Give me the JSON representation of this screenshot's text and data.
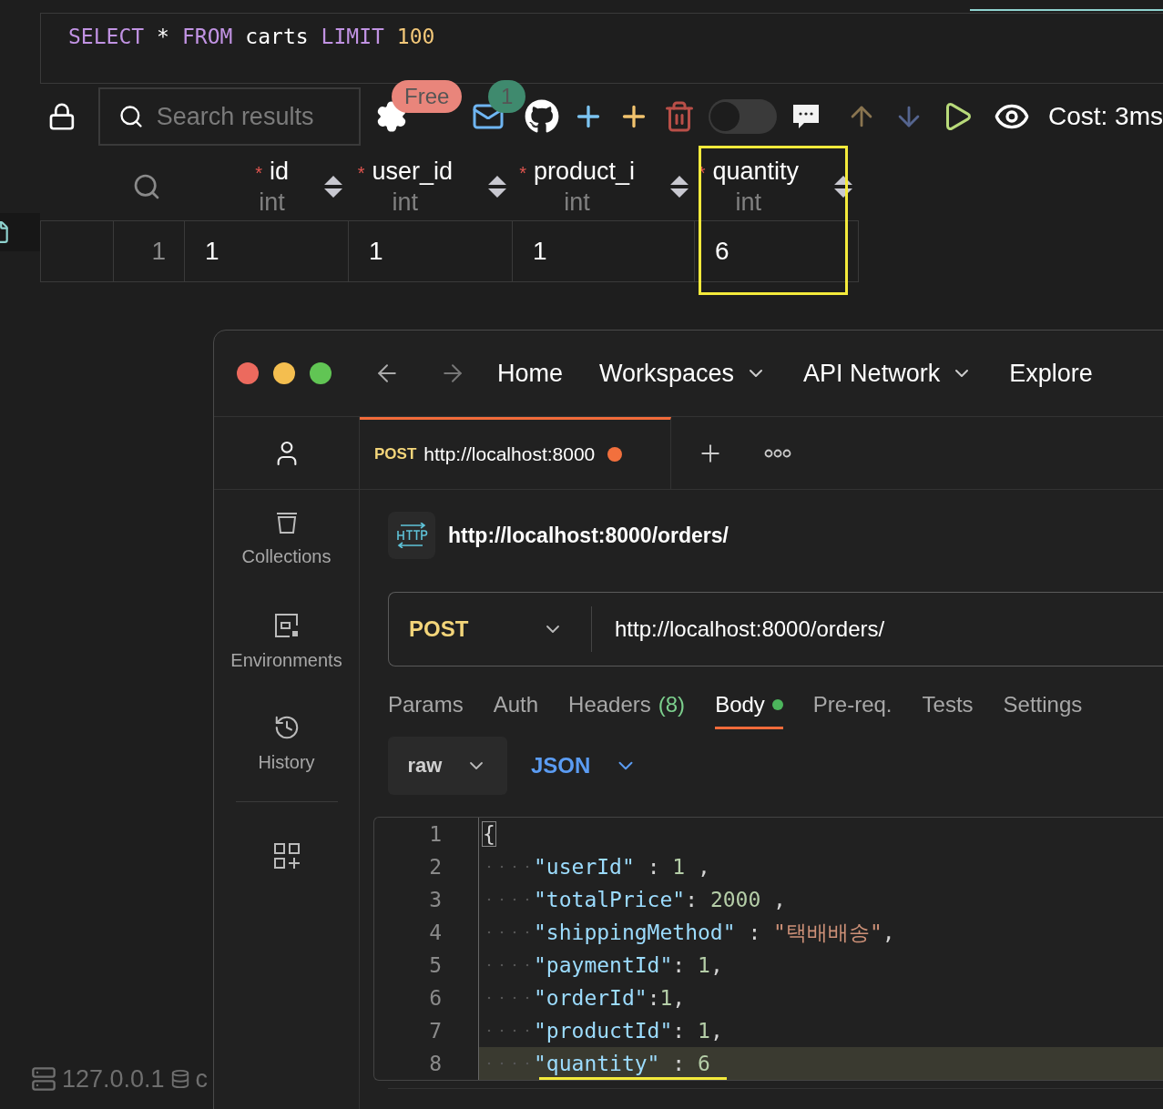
{
  "query_editor": {
    "tokens": [
      {
        "text": "SELECT",
        "kind": "keyword"
      },
      {
        "text": "*",
        "kind": "plain"
      },
      {
        "text": "FROM",
        "kind": "keyword"
      },
      {
        "text": "carts",
        "kind": "plain"
      },
      {
        "text": "LIMIT",
        "kind": "keyword"
      },
      {
        "text": "100",
        "kind": "number"
      }
    ]
  },
  "toolbar": {
    "search": {
      "placeholder": "Search results"
    },
    "settings_badge": "Free",
    "mail_badge": "1",
    "toggle": {
      "on": false
    },
    "cost": "Cost: 3ms"
  },
  "table": {
    "columns": [
      {
        "name": "id",
        "type": "int",
        "required": true,
        "highlighted": false
      },
      {
        "name": "user_id",
        "type": "int",
        "required": true,
        "highlighted": false
      },
      {
        "name": "product_i",
        "type": "int",
        "required": true,
        "highlighted": false
      },
      {
        "name": "quantity",
        "type": "int",
        "required": true,
        "highlighted": true
      }
    ],
    "rows": [
      {
        "row_number": "1",
        "cells": [
          "1",
          "1",
          "1",
          "6"
        ]
      }
    ]
  },
  "status_bar": {
    "host": "127.0.0.1",
    "database": "c"
  },
  "postman": {
    "nav": [
      {
        "label": "Home",
        "dropdown": false
      },
      {
        "label": "Workspaces",
        "dropdown": true
      },
      {
        "label": "API Network",
        "dropdown": true
      },
      {
        "label": "Explore",
        "dropdown": false
      }
    ],
    "sidebar": [
      {
        "label": "Collections"
      },
      {
        "label": "Environments"
      },
      {
        "label": "History"
      }
    ],
    "open_tab": {
      "method": "POST",
      "url": "http://localhost:8000",
      "unsaved": true
    },
    "request": {
      "title": "http://localhost:8000/orders/",
      "method": "POST",
      "url": "http://localhost:8000/orders/"
    },
    "request_tabs": [
      {
        "label": "Params",
        "selected": false,
        "has_content": false
      },
      {
        "label": "Auth",
        "selected": false,
        "has_content": false
      },
      {
        "label": "Headers",
        "count": "(8)",
        "selected": false,
        "has_content": false
      },
      {
        "label": "Body",
        "selected": true,
        "has_content": true
      },
      {
        "label": "Pre-req.",
        "selected": false,
        "has_content": false
      },
      {
        "label": "Tests",
        "selected": false,
        "has_content": false
      },
      {
        "label": "Settings",
        "selected": false,
        "has_content": false
      }
    ],
    "body": {
      "mode": "raw",
      "language": "JSON",
      "lines": [
        {
          "number": "1",
          "current": false,
          "underlined": false,
          "indented": false,
          "tokens": [
            {
              "text": "{",
              "kind": "bracket"
            }
          ]
        },
        {
          "number": "2",
          "current": false,
          "underlined": false,
          "indented": true,
          "tokens": [
            {
              "text": "\"userId\"",
              "kind": "key"
            },
            {
              "text": " : ",
              "kind": "punct"
            },
            {
              "text": "1",
              "kind": "number"
            },
            {
              "text": " ,",
              "kind": "punct"
            }
          ]
        },
        {
          "number": "3",
          "current": false,
          "underlined": false,
          "indented": true,
          "tokens": [
            {
              "text": "\"totalPrice\"",
              "kind": "key"
            },
            {
              "text": ": ",
              "kind": "punct"
            },
            {
              "text": "2000",
              "kind": "number"
            },
            {
              "text": " ,",
              "kind": "punct"
            }
          ]
        },
        {
          "number": "4",
          "current": false,
          "underlined": false,
          "indented": true,
          "tokens": [
            {
              "text": "\"shippingMethod\"",
              "kind": "key"
            },
            {
              "text": " : ",
              "kind": "punct"
            },
            {
              "text": "\"택배배송\"",
              "kind": "string"
            },
            {
              "text": ",",
              "kind": "punct"
            }
          ]
        },
        {
          "number": "5",
          "current": false,
          "underlined": false,
          "indented": true,
          "tokens": [
            {
              "text": "\"paymentId\"",
              "kind": "key"
            },
            {
              "text": ": ",
              "kind": "punct"
            },
            {
              "text": "1",
              "kind": "number"
            },
            {
              "text": ",",
              "kind": "punct"
            }
          ]
        },
        {
          "number": "6",
          "current": false,
          "underlined": false,
          "indented": true,
          "tokens": [
            {
              "text": "\"orderId\"",
              "kind": "key"
            },
            {
              "text": ":",
              "kind": "punct"
            },
            {
              "text": "1",
              "kind": "number"
            },
            {
              "text": ",",
              "kind": "punct"
            }
          ]
        },
        {
          "number": "7",
          "current": false,
          "underlined": false,
          "indented": true,
          "tokens": [
            {
              "text": "\"productId\"",
              "kind": "key"
            },
            {
              "text": ": ",
              "kind": "punct"
            },
            {
              "text": "1",
              "kind": "number"
            },
            {
              "text": ",",
              "kind": "punct"
            }
          ]
        },
        {
          "number": "8",
          "current": true,
          "underlined": true,
          "indented": true,
          "tokens": [
            {
              "text": "\"quantity\"",
              "kind": "key"
            },
            {
              "text": " : ",
              "kind": "punct"
            },
            {
              "text": "6",
              "kind": "number"
            }
          ]
        }
      ]
    }
  }
}
